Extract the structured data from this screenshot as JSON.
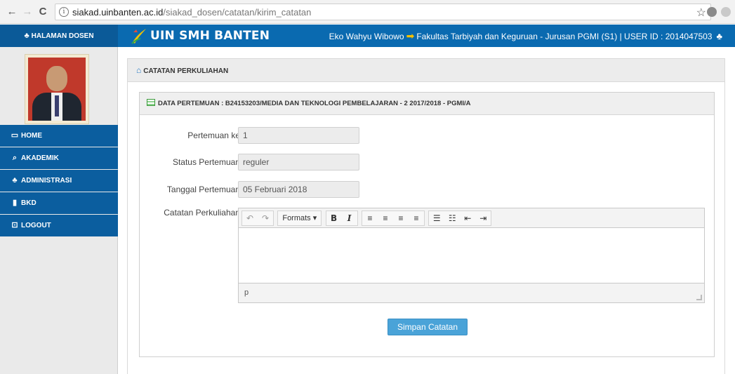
{
  "browser": {
    "url_domain": "siakad.uinbanten.ac.id",
    "url_path": "/siakad_dosen/catatan/kirim_catatan",
    "back_icon": "←",
    "forward_icon": "→",
    "reload_icon": "C",
    "info_icon": "i",
    "star_icon": "☆"
  },
  "header": {
    "sidebar_title": "HALAMAN DOSEN",
    "brand": "UIN SMH BANTEN",
    "user_name": "Eko Wahyu Wibowo",
    "user_faculty": "Fakultas Tarbiyah dan Keguruan - Jurusan PGMI (S1) | USER ID : 2014047503",
    "arrow_icon": "➡",
    "user_icon": "♣"
  },
  "sidebar": {
    "items": [
      {
        "label": "HOME",
        "icon": "monitor-icon",
        "glyph": "▭"
      },
      {
        "label": "AKADEMIK",
        "icon": "search-icon",
        "glyph": "⌕"
      },
      {
        "label": "ADMINISTRASI",
        "icon": "users-icon",
        "glyph": "♣"
      },
      {
        "label": "BKD",
        "icon": "book-icon",
        "glyph": "▮"
      },
      {
        "label": "LOGOUT",
        "icon": "logout-icon",
        "glyph": "⊡"
      }
    ]
  },
  "content": {
    "title": "CATATAN PERKULIAHAN",
    "panel_title": "DATA PERTEMUAN : B24153203/MEDIA DAN TEKNOLOGI PEMBELAJARAN - 2 2017/2018 - PGMI/A",
    "fields": {
      "meeting_no": {
        "label": "Pertemuan ke",
        "value": "1"
      },
      "status": {
        "label": "Status Pertemuan",
        "value": "reguler"
      },
      "date": {
        "label": "Tanggal Pertemuan",
        "value": "05 Februari 2018"
      },
      "notes": {
        "label": "Catatan Perkuliahan"
      }
    },
    "editor": {
      "undo": "↶",
      "redo": "↷",
      "formats": "Formats ▾",
      "bold": "B",
      "italic": "I",
      "align_left": "≡",
      "align_center": "≡",
      "align_right": "≡",
      "justify": "≡",
      "bullet_list": "☰",
      "numbered_list": "☷",
      "outdent": "⇤",
      "indent": "⇥",
      "status_path": "p",
      "content": ""
    },
    "save_label": "Simpan Catatan"
  },
  "colors": {
    "header_blue": "#0a6ab0",
    "menu_blue": "#0b5e9f",
    "save_button": "#4aa3d8",
    "arrow_yellow": "#f5c000"
  }
}
